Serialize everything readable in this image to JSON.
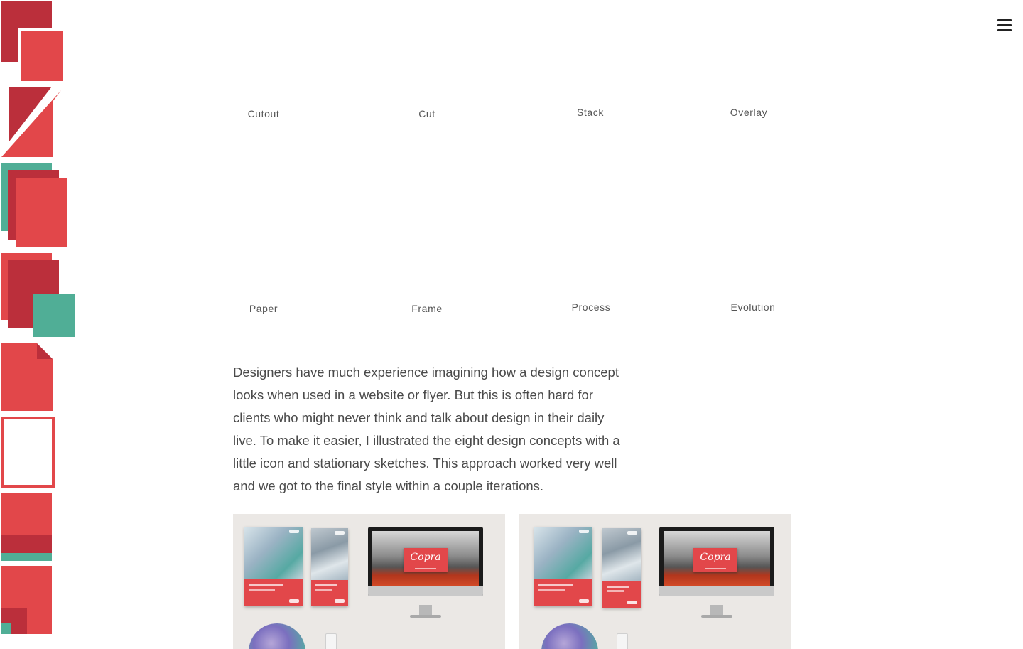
{
  "header": {
    "menu_icon": "hamburger-menu-icon"
  },
  "colors": {
    "red": "#E2474A",
    "dark_red": "#BB2F3B",
    "teal": "#50AE96",
    "text": "#4A4A4A"
  },
  "concepts": [
    {
      "label": "Cutout"
    },
    {
      "label": "Cut"
    },
    {
      "label": "Stack"
    },
    {
      "label": "Overlay"
    },
    {
      "label": "Paper"
    },
    {
      "label": "Frame"
    },
    {
      "label": "Process"
    },
    {
      "label": "Evolution"
    }
  ],
  "intro_text": "Designers have much experience imagining how a design concept looks when used in a website or flyer. But this is often hard for clients who might never think and talk about design in their daily live. To make it easier, I illustrated the eight design concepts with a little icon and stationary sketches. This approach worked very well and we got to the final style within a couple iterations.",
  "mockups": [
    {
      "brand": "Copra"
    },
    {
      "brand": "Copra"
    }
  ]
}
